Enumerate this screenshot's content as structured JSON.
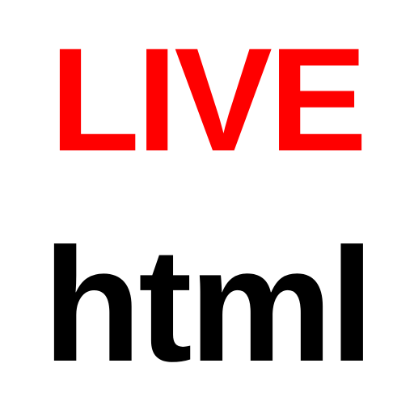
{
  "logo": {
    "top_text": "LIVE",
    "bottom_text": "html",
    "colors": {
      "top_text": "#ff0000",
      "bottom_text": "#000000",
      "background": "#ffffff"
    }
  }
}
